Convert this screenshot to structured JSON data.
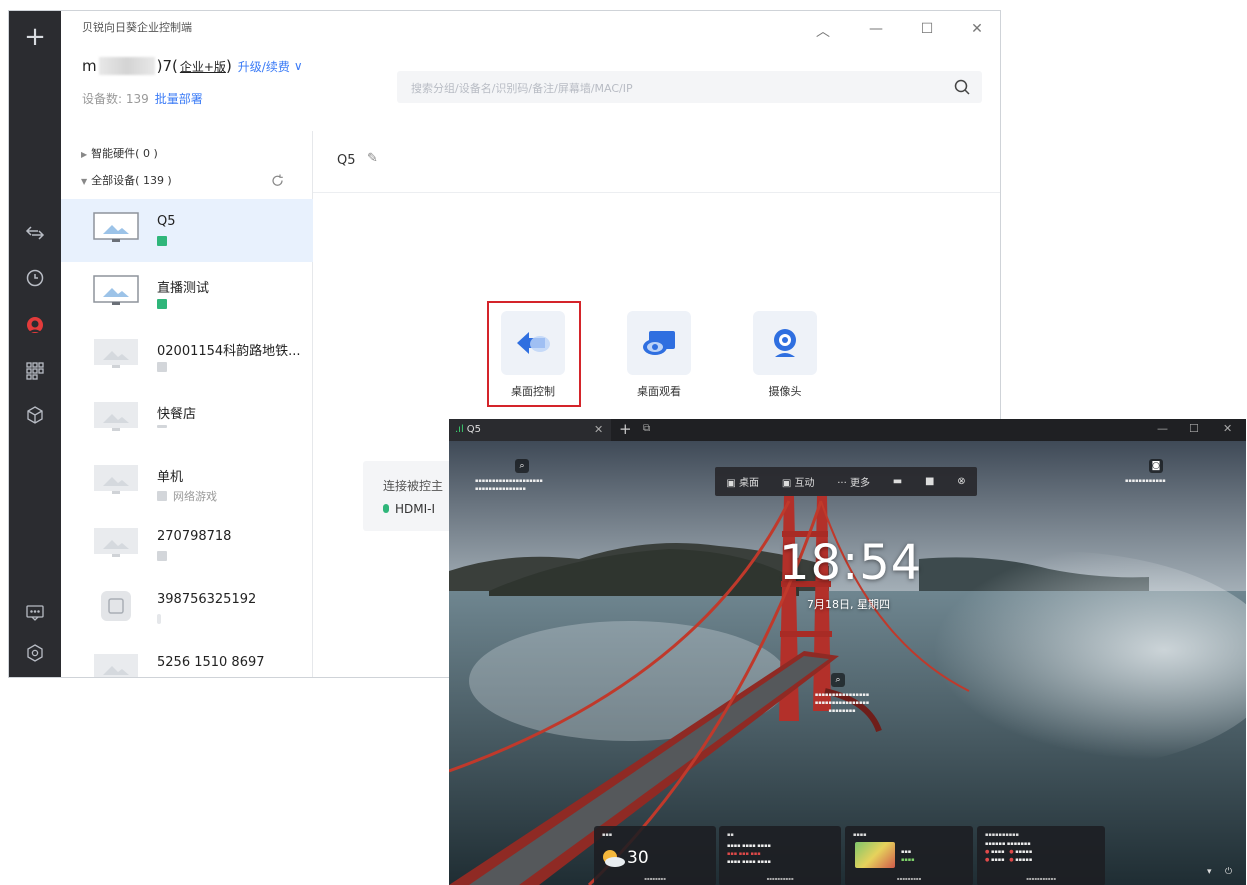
{
  "app": {
    "title": "贝锐向日葵企业控制端",
    "window_controls": {
      "collapse": "︿",
      "minimize": "—",
      "maximize": "☐",
      "close": "✕"
    },
    "account": {
      "prefix": "m",
      "suffix": ")7(",
      "edition": "企业+版",
      "edition_close": ")",
      "upgrade": "升级/续费",
      "chevron": "∨"
    },
    "device_count_label": "设备数: 139",
    "bulk_deploy": "批量部署",
    "search_placeholder": "搜索分组/设备名/识别码/备注/屏幕墙/MAC/IP"
  },
  "sidebar_icons": [
    "plus-icon",
    "remote-arrows-icon",
    "history-clock-icon",
    "sunflower-logo-icon",
    "apps-grid-icon",
    "cube-icon",
    "message-icon",
    "settings-icon"
  ],
  "tree": {
    "smart_hw": "智能硬件( 0 )",
    "all_devices": "全部设备( 139 )",
    "devices": [
      {
        "name": "Q5",
        "sub": "",
        "status": "#2fb67a"
      },
      {
        "name": "直播测试",
        "sub": "",
        "status": "#2fb67a"
      },
      {
        "name": "02001154科韵路地铁...",
        "sub": "",
        "status": "#cfd2d6"
      },
      {
        "name": "快餐店",
        "sub": "",
        "status": "#cfd2d6"
      },
      {
        "name": "单机",
        "sub": "网络游戏",
        "status": "#cfd2d6"
      },
      {
        "name": "270798718",
        "sub": "",
        "status": "#cfd2d6"
      },
      {
        "name": "398756325192",
        "sub": "",
        "status": "#cfd2d6"
      },
      {
        "name": "5256 1510 8697",
        "sub": "",
        "status": "#cfd2d6"
      }
    ]
  },
  "detail": {
    "device_name": "Q5",
    "actions": [
      {
        "label": "桌面控制"
      },
      {
        "label": "桌面观看"
      },
      {
        "label": "摄像头"
      }
    ],
    "connection_label": "连接被控主",
    "connection_value": "HDMI-I"
  },
  "remote": {
    "tab_label": "Q5",
    "toolbar": [
      "桌面",
      "互动",
      "··· 更多"
    ],
    "time": "18:54",
    "date": "7月18日, 星期四",
    "weather_temp": "30",
    "colors": {
      "accent": "#3b7bf6",
      "online": "#2fb67a",
      "highlight": "#d4242a",
      "bridge": "#c0392b"
    }
  }
}
